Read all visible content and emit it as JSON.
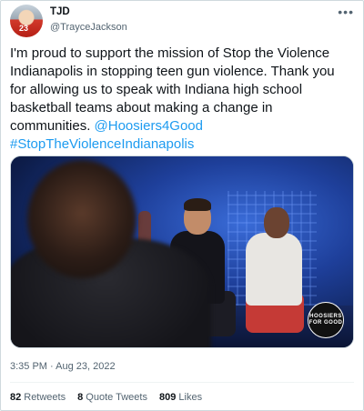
{
  "author": {
    "display_name": "TJD",
    "handle": "@TrayceJackson",
    "avatar_jersey": "23"
  },
  "tweet": {
    "lines": [
      "I'm proud to support the mission of Stop the Violence",
      "Indianapolis in stopping teen gun violence. Thank you",
      "for allowing us to speak with Indiana high school",
      "basketball teams about making a change in"
    ],
    "last_line_text": "communities. ",
    "mention": "@Hoosiers4Good",
    "hashtag": "#StopTheViolenceIndianapolis"
  },
  "media": {
    "badge_text": "HOOSIERS FOR GOOD"
  },
  "timestamp": "3:35 PM · Aug 23, 2022",
  "stats": {
    "retweets_count": "82",
    "retweets_label": "Retweets",
    "quotes_count": "8",
    "quotes_label": "Quote Tweets",
    "likes_count": "809",
    "likes_label": "Likes"
  },
  "icons": {
    "more": "more-options-icon"
  },
  "colors": {
    "link": "#1d9bf0",
    "secondary_text": "#536471",
    "primary_text": "#0f1419"
  }
}
